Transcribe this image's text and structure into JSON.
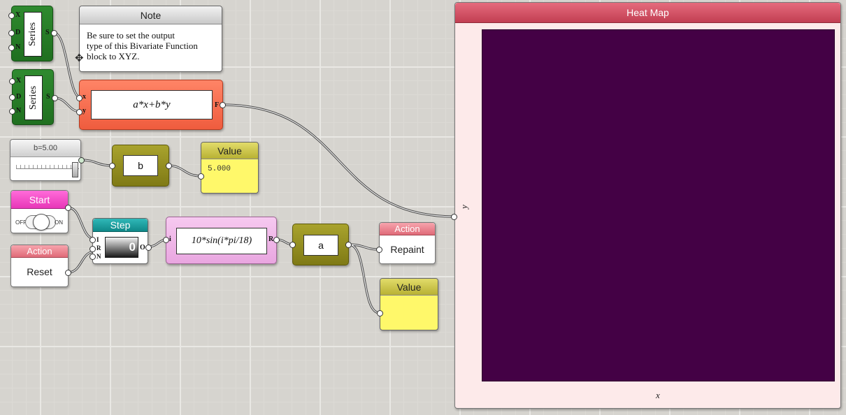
{
  "series_top": {
    "label": "Series",
    "inputs": [
      "X",
      "D",
      "N"
    ],
    "output": "S"
  },
  "series_bottom": {
    "label": "Series",
    "inputs": [
      "X",
      "D",
      "N"
    ],
    "output": "S"
  },
  "note": {
    "title": "Note",
    "lines": [
      "Be sure to set the output",
      "type of this Bivariate Function",
      "block to XYZ."
    ]
  },
  "bivariate_function": {
    "expression": "a*x+b*y",
    "inputs": [
      "x",
      "y"
    ],
    "output": "F"
  },
  "slider": {
    "label": "b=5.00",
    "value": 5.0,
    "min": 0,
    "max": 5
  },
  "variable_b": {
    "label": "b"
  },
  "value_b": {
    "title": "Value",
    "text": "5.000"
  },
  "start": {
    "title": "Start",
    "off_label": "OFF",
    "on_label": "ON",
    "state": "off"
  },
  "action_reset": {
    "title": "Action",
    "label": "Reset"
  },
  "step": {
    "title": "Step",
    "inputs": [
      "I",
      "R",
      "N"
    ],
    "output": "O",
    "count": "0"
  },
  "sin_function": {
    "expression": "10*sin(i*pi/18)",
    "input": "i",
    "output": "R"
  },
  "variable_a": {
    "label": "a"
  },
  "action_repaint": {
    "title": "Action",
    "label": "Repaint"
  },
  "value_a": {
    "title": "Value",
    "text": ""
  },
  "heatmap": {
    "title": "Heat Map",
    "xlabel": "x",
    "ylabel": "y",
    "fill_color": "#440145"
  },
  "colors": {
    "series": "#2f8a2f",
    "function": "#ef5c3e",
    "variable": "#8f8a1f",
    "value": "#fff86a",
    "step": "#0f8888",
    "heatmap_header": "#c23e52"
  }
}
